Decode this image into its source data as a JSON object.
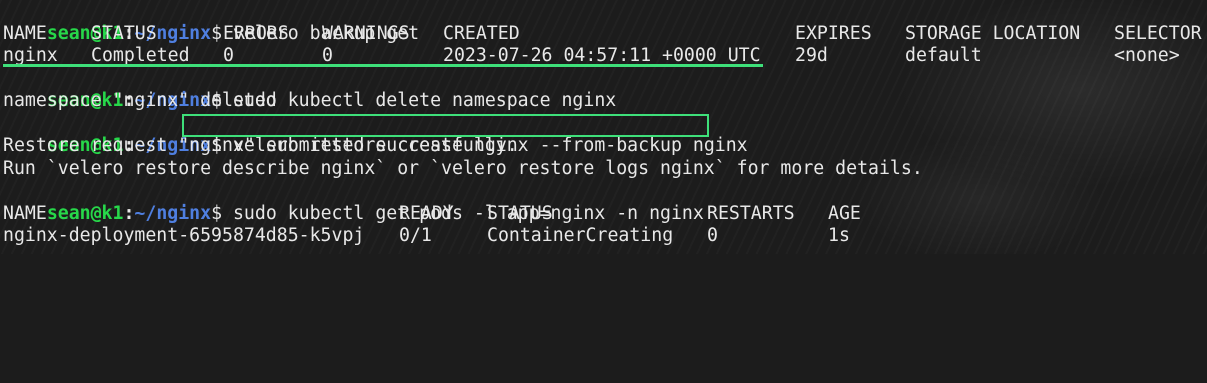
{
  "prompt": {
    "user": "sean@k1",
    "sep": ":",
    "path": "~/nginx",
    "symbol": "$"
  },
  "commands": {
    "backup_get": "velero backup get",
    "delete_ns": "sudo kubectl delete namespace nginx",
    "restore_create": "velero restore create nginx --from-backup nginx",
    "get_pods": "sudo kubectl get pods -l app=nginx -n nginx"
  },
  "backup_table": {
    "headers": [
      "NAME",
      "STATUS",
      "ERRORS",
      "WARNINGS",
      "CREATED",
      "EXPIRES",
      "STORAGE LOCATION",
      "SELECTOR"
    ],
    "rows": [
      [
        "nginx",
        "Completed",
        "0",
        "0",
        "2023-07-26 04:57:11 +0000 UTC",
        "29d",
        "default",
        "<none>"
      ]
    ]
  },
  "outputs": {
    "delete_result": "namespace \"nginx\" deleted",
    "restore_submitted": "Restore request \"nginx\" submitted successfully.",
    "restore_hint": "Run `velero restore describe nginx` or `velero restore logs nginx` for more details."
  },
  "pods_table": {
    "headers": [
      "NAME",
      "READY",
      "STATUS",
      "RESTARTS",
      "AGE"
    ],
    "rows": [
      [
        "nginx-deployment-6595874d85-k5vpj",
        "0/1",
        "ContainerCreating",
        "0",
        "1s"
      ]
    ]
  },
  "colors": {
    "prompt_user": "#27d84a",
    "prompt_path": "#4f7fe0",
    "highlight": "#3ee07a",
    "background": "#1c1c1c",
    "text": "#e8e8e8"
  }
}
